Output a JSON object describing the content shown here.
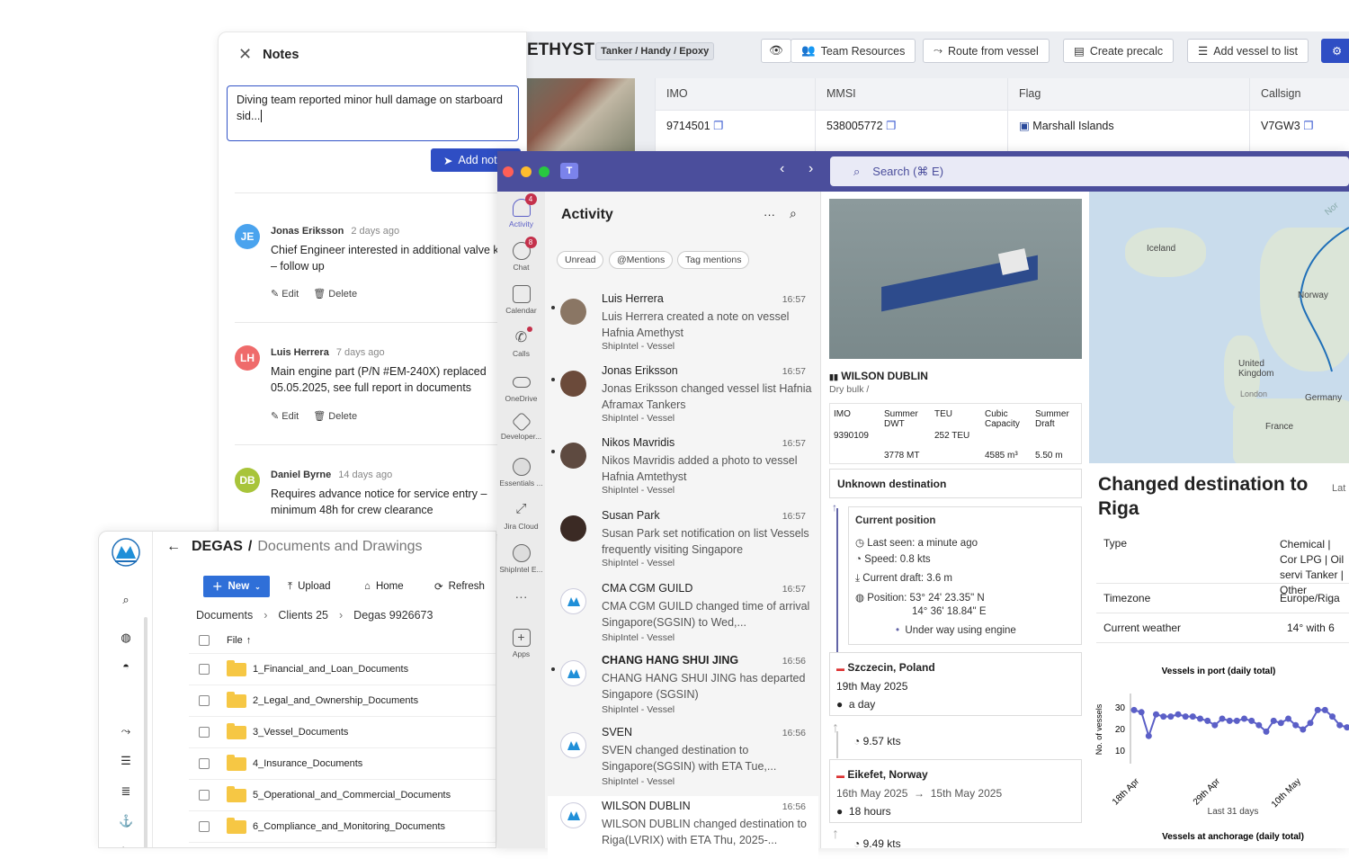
{
  "vessel": {
    "title_fragment": "ETHYST",
    "tag": "Tanker / Handy / Epoxy",
    "buttons": [
      "Team Resources",
      "Route from vessel",
      "Create precalc",
      "Add vessel to list"
    ],
    "table": [
      {
        "header": "IMO",
        "value": "9714501"
      },
      {
        "header": "MMSI",
        "value": "538005772"
      },
      {
        "header": "Flag",
        "value": "Marshall Islands"
      },
      {
        "header": "Callsign",
        "value": "V7GW3"
      }
    ]
  },
  "notes": {
    "title": "Notes",
    "input_value": "Diving team reported minor hull damage on starboard sid...",
    "add_label": "Add not",
    "edit_label": "Edit",
    "delete_label": "Delete",
    "items": [
      {
        "initials": "JE",
        "color": "#4aa3ee",
        "author": "Jonas Eriksson",
        "ago": "2 days ago",
        "text": "Chief Engineer interested in additional valve kits – follow up"
      },
      {
        "initials": "LH",
        "color": "#ef6b6b",
        "author": "Luis Herrera",
        "ago": "7 days ago",
        "text": "Main engine part (P/N #EM-240X) replaced 05.05.2025, see full report in documents"
      },
      {
        "initials": "DB",
        "color": "#a8c43a",
        "author": "Daniel Byrne",
        "ago": "14 days ago",
        "text": "Requires advance notice for service entry – minimum 48h for crew clearance"
      }
    ]
  },
  "docs": {
    "brand": "DEGAS",
    "section": "Documents and Drawings",
    "toolbar": {
      "new": "New",
      "upload": "Upload",
      "home": "Home",
      "refresh": "Refresh"
    },
    "path": [
      "Documents",
      "Clients 25",
      "Degas 9926673"
    ],
    "column": "File",
    "folders": [
      "1_Financial_and_Loan_Documents",
      "2_Legal_and_Ownership_Documents",
      "3_Vessel_Documents",
      "4_Insurance_Documents",
      "5_Operational_and_Commercial_Documents",
      "6_Compliance_and_Monitoring_Documents"
    ]
  },
  "teams": {
    "search": "Search (⌘ E)",
    "apps": [
      {
        "label": "Activity",
        "badge": "4"
      },
      {
        "label": "Chat",
        "badge": "8"
      },
      {
        "label": "Calendar",
        "badge": ""
      },
      {
        "label": "Calls",
        "badge": ""
      },
      {
        "label": "OneDrive",
        "badge": ""
      },
      {
        "label": "Developer...",
        "badge": ""
      },
      {
        "label": "Essentials ...",
        "badge": ""
      },
      {
        "label": "Jira Cloud",
        "badge": ""
      },
      {
        "label": "ShipIntel E...",
        "badge": ""
      },
      {
        "label": "Apps",
        "badge": ""
      }
    ],
    "activity_title": "Activity",
    "filters": [
      "Unread",
      "@Mentions",
      "Tag mentions"
    ],
    "feed": [
      {
        "name": "Luis Herrera",
        "time": "16:57",
        "desc": "Luis Herrera created a note on vessel Hafnia Amethyst",
        "source": "ShipIntel - Vessel"
      },
      {
        "name": "Jonas Eriksson",
        "time": "16:57",
        "desc": "Jonas Eriksson changed vessel list Hafnia Aframax Tankers",
        "source": "ShipIntel - Vessel"
      },
      {
        "name": "Nikos Mavridis",
        "time": "16:57",
        "desc": "Nikos Mavridis added a photo to vessel Hafnia Amtethyst",
        "source": "ShipIntel - Vessel"
      },
      {
        "name": "Susan Park",
        "time": "16:57",
        "desc": "Susan Park set notification on list Vessels frequently visiting Singapore",
        "source": "ShipIntel - Vessel"
      },
      {
        "name": "CMA CGM GUILD",
        "time": "16:57",
        "desc": "CMA CGM GUILD changed time of arrival Singapore(SGSIN) to Wed,...",
        "source": "ShipIntel - Vessel"
      },
      {
        "name": "CHANG HANG SHUI JING",
        "time": "16:56",
        "desc": "CHANG HANG SHUI JING has departed Singapore (SGSIN)",
        "source": "ShipIntel - Vessel"
      },
      {
        "name": "SVEN",
        "time": "16:56",
        "desc": "SVEN changed destination to Singapore(SGSIN) with ETA Tue,...",
        "source": "ShipIntel - Vessel"
      },
      {
        "name": "WILSON DUBLIN",
        "time": "16:56",
        "desc": "WILSON DUBLIN changed destination to Riga(LVRIX) with ETA Thu, 2025-...",
        "source": ""
      }
    ]
  },
  "vessel_card": {
    "name": "WILSON DUBLIN",
    "type": "Dry bulk /",
    "specs": [
      {
        "label": "IMO",
        "value": "9390109"
      },
      {
        "label": "Summer DWT",
        "value": "3778 MT"
      },
      {
        "label": "TEU",
        "value": "252 TEU"
      },
      {
        "label": "Cubic Capacity",
        "value": "4585 m³"
      },
      {
        "label": "Summer Draft",
        "value": "5.50 m"
      }
    ],
    "destination": "Unknown destination",
    "position_title": "Current position",
    "last_seen": "Last seen: a minute ago",
    "speed": "Speed: 0.8 kts",
    "draft": "Current draft: 3.6 m",
    "position_lat": "Position: 53° 24' 23.35\" N",
    "position_lon": "14° 36' 18.84\" E",
    "status": "Under way using engine",
    "port1": {
      "name": "Szczecin, Poland",
      "date": "19th May 2025",
      "duration": "a day"
    },
    "leg_speed1": "9.57 kts",
    "port2": {
      "name": "Eikefet, Norway",
      "arr": "16th May 2025",
      "dep": "15th May 2025",
      "duration": "18 hours"
    },
    "leg_speed2": "9.49 kts"
  },
  "map_labels": [
    "Iceland",
    "Norway",
    "United Kingdom",
    "London",
    "Germany",
    "France",
    "Nor"
  ],
  "right_panel": {
    "heading": "Changed destination to Riga",
    "side_label": "Lat (LV",
    "rows": [
      {
        "label": "Type",
        "value": "Chemical | Cor LPG | Oil servi Tanker | Other"
      },
      {
        "label": "Timezone",
        "value": "Europe/Riga"
      },
      {
        "label": "Current weather",
        "value": "14° with 6"
      }
    ],
    "chart2_title": "Vessels at anchorage (daily total)"
  },
  "chart_data": {
    "type": "line",
    "title": "Vessels in port (daily total)",
    "xlabel": "Last 31 days",
    "ylabel": "No. of vessels",
    "x_ticks": [
      "18th Apr",
      "29th Apr",
      "10th May"
    ],
    "y_ticks": [
      10,
      20,
      30
    ],
    "ylim": [
      5,
      35
    ],
    "values": [
      29,
      28,
      17,
      27,
      26,
      26,
      27,
      26,
      26,
      25,
      24,
      22,
      25,
      24,
      24,
      25,
      24,
      22,
      19,
      24,
      23,
      25,
      22,
      20,
      23,
      29,
      29,
      26,
      22,
      21,
      20
    ]
  }
}
